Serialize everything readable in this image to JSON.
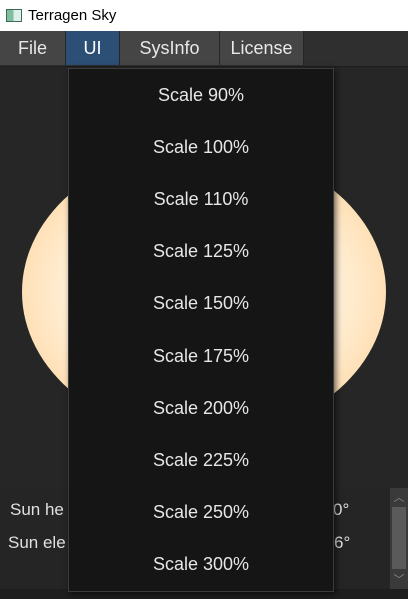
{
  "window": {
    "title": "Terragen Sky"
  },
  "menubar": {
    "items": [
      "File",
      "UI",
      "SysInfo",
      "License"
    ],
    "active": "UI"
  },
  "info": {
    "line1_label": "Sun he",
    "line1_value": "0°",
    "line2_label": "Sun ele",
    "line2_value": "6°"
  },
  "ui_menu": {
    "options": [
      "Scale 90%",
      "Scale 100%",
      "Scale 110%",
      "Scale 125%",
      "Scale 150%",
      "Scale 175%",
      "Scale 200%",
      "Scale 225%",
      "Scale 250%",
      "Scale 300%"
    ]
  },
  "colors": {
    "menu_active": "#2c4f76",
    "dropdown_bg": "#151515"
  }
}
